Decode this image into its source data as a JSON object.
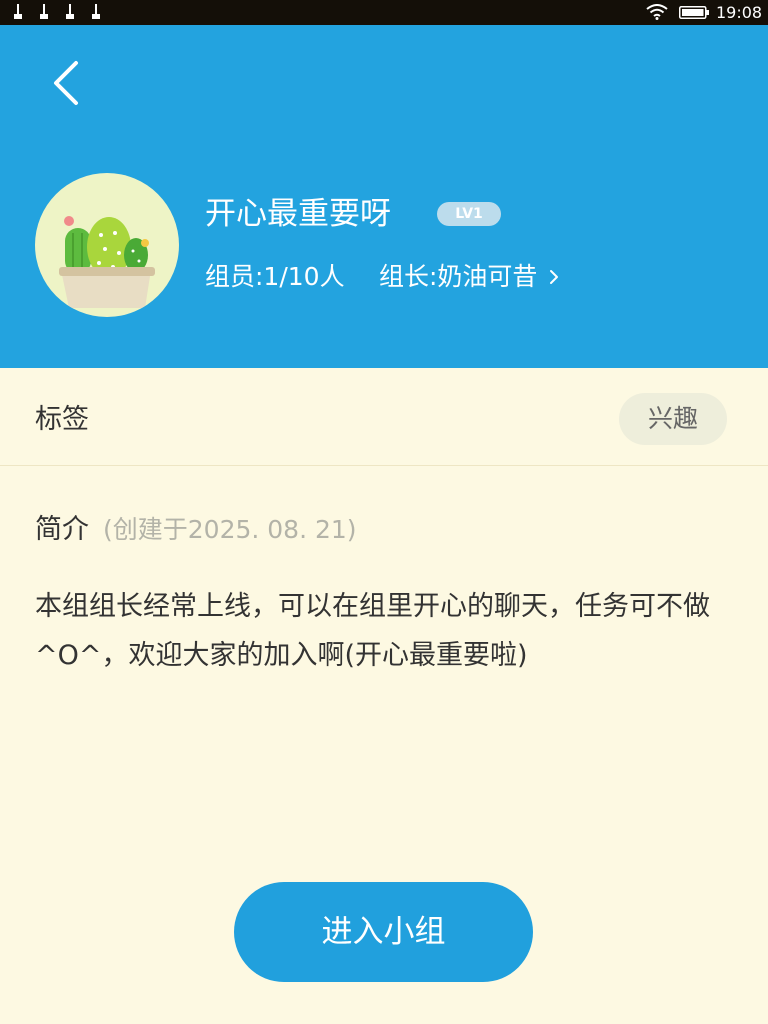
{
  "status_bar": {
    "time": "19:08",
    "icons": [
      "usb-icon",
      "usb-icon",
      "usb-icon",
      "usb-icon",
      "wifi-icon",
      "battery-icon"
    ]
  },
  "header": {
    "back_icon": "chevron-left-icon",
    "group_name": "开心最重要呀",
    "level": "LV1",
    "members": "组员:1/10人",
    "leader": "组长:奶油可昔",
    "leader_icon": "chevron-right-icon",
    "avatar_icon": "cactus-icon"
  },
  "tags": {
    "label": "标签",
    "value": "兴趣"
  },
  "intro": {
    "title": "简介",
    "created": "(创建于2025. 08. 21)",
    "body": "本组组长经常上线，可以在组里开心的聊天，任务可不做^O^，欢迎大家的加入啊(开心最重要啦)"
  },
  "actions": {
    "join_label": "进入小组"
  },
  "colors": {
    "header_bg": "#23a3df",
    "page_bg": "#fdf9e2",
    "button_bg": "#21a0dd",
    "status_bar_bg": "#140f08"
  }
}
